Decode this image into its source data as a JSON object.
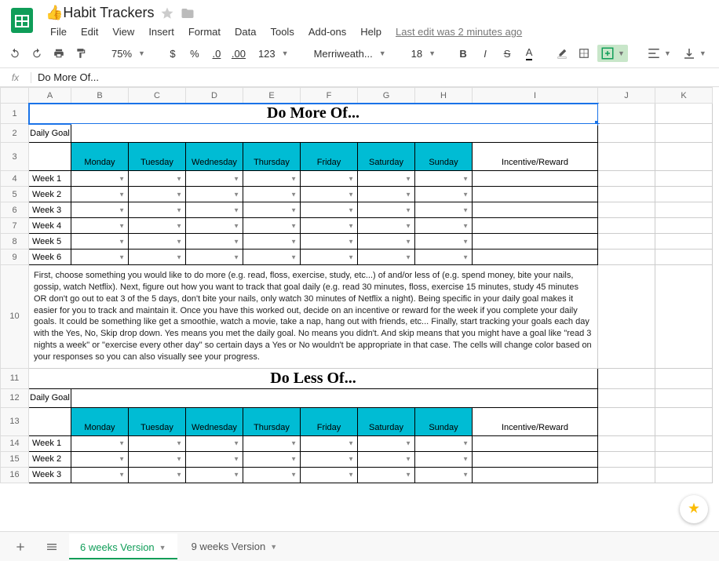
{
  "doc": {
    "title": "👍Habit Trackers",
    "lastEdit": "Last edit was 2 minutes ago"
  },
  "menu": {
    "file": "File",
    "edit": "Edit",
    "view": "View",
    "insert": "Insert",
    "format": "Format",
    "data": "Data",
    "tools": "Tools",
    "addons": "Add-ons",
    "help": "Help"
  },
  "toolbar": {
    "zoom": "75%",
    "dollar": "$",
    "percent": "%",
    "dec0": ".0",
    "dec00": ".00",
    "numfmt": "123",
    "font": "Merriweath...",
    "fontsize": "18",
    "bold": "B",
    "italic": "I",
    "strike": "S",
    "acolor": "A"
  },
  "formula": {
    "fx": "fx",
    "value": "Do More Of..."
  },
  "cols": [
    "",
    "A",
    "B",
    "C",
    "D",
    "E",
    "F",
    "G",
    "H",
    "I",
    "J",
    "K"
  ],
  "section1": {
    "title": "Do More Of...",
    "dailyGoal": "Daily Goal",
    "days": [
      "Monday",
      "Tuesday",
      "Wednesday",
      "Thursday",
      "Friday",
      "Saturday",
      "Sunday"
    ],
    "incentive": "Incentive/Reward",
    "weeks": [
      "Week 1",
      "Week 2",
      "Week 3",
      "Week 4",
      "Week 5",
      "Week 6"
    ]
  },
  "instructions": "First, choose something you would like to do more (e.g. read, floss, exercise, study, etc...) of and/or less of (e.g. spend money, bite your nails, gossip, watch Netflix). Next, figure out how you want to track that goal daily (e.g. read 30 minutes, floss, exercise 15 minutes, study 45 minutes OR don't go out to eat 3 of the 5 days, don't bite your nails, only watch 30 minutes of Netflix a night). Being specific in your daily goal makes it easier for you to track and maintain it. Once you have this worked out, decide on an incentive or reward for the week if you complete your daily goals. It could be something like get a smoothie, watch a movie, take a nap, hang out with friends, etc... Finally, start tracking your goals each day with the Yes, No, Skip drop down. Yes means you met the daily goal. No means you didn't. And skip means that you might have a goal like \"read 3 nights a week\" or \"exercise every other day\" so certain days a Yes or No wouldn't be appropriate in that case. The cells will change color based on your responses so you can also visually see your progress.",
  "section2": {
    "title": "Do Less Of...",
    "dailyGoal": "Daily Goal",
    "days": [
      "Monday",
      "Tuesday",
      "Wednesday",
      "Thursday",
      "Friday",
      "Saturday",
      "Sunday"
    ],
    "incentive": "Incentive/Reward",
    "weeks": [
      "Week 1",
      "Week 2",
      "Week 3"
    ]
  },
  "rowNums": [
    "1",
    "2",
    "3",
    "4",
    "5",
    "6",
    "7",
    "8",
    "9",
    "10",
    "11",
    "12",
    "13",
    "14",
    "15",
    "16"
  ],
  "tabs": {
    "t1": "6 weeks Version",
    "t2": "9 weeks Version"
  }
}
